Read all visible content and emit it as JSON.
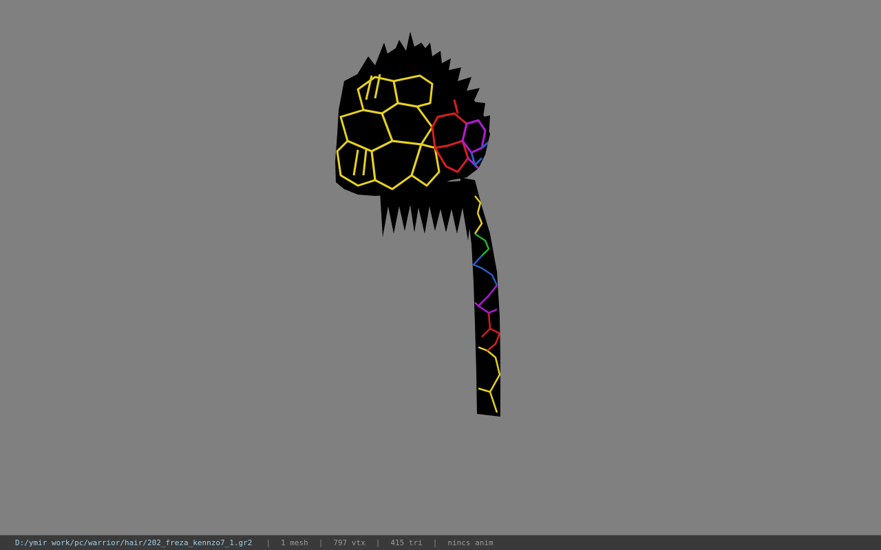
{
  "viewport": {
    "background_color": "#808080",
    "model": {
      "name": "hair-mesh",
      "base_color": "#000000",
      "pattern": "hexagon-grid",
      "pattern_colors": [
        "#ffe81a",
        "#ff1a1a",
        "#c21ad6",
        "#2a6fd6",
        "#1ad62a"
      ]
    }
  },
  "status_bar": {
    "file_path": "D:/ymir work/pc/warrior/hair/202_freza_kennzo7_1.gr2",
    "separator": "|",
    "mesh_count": "1 mesh",
    "vertex_count": "797 vtx",
    "triangle_count": "415 tri",
    "anim_status": "nincs anim",
    "colors": {
      "background": "#3a3a3a",
      "path_text": "#9fd0e8",
      "text": "#9a9a9a"
    }
  }
}
